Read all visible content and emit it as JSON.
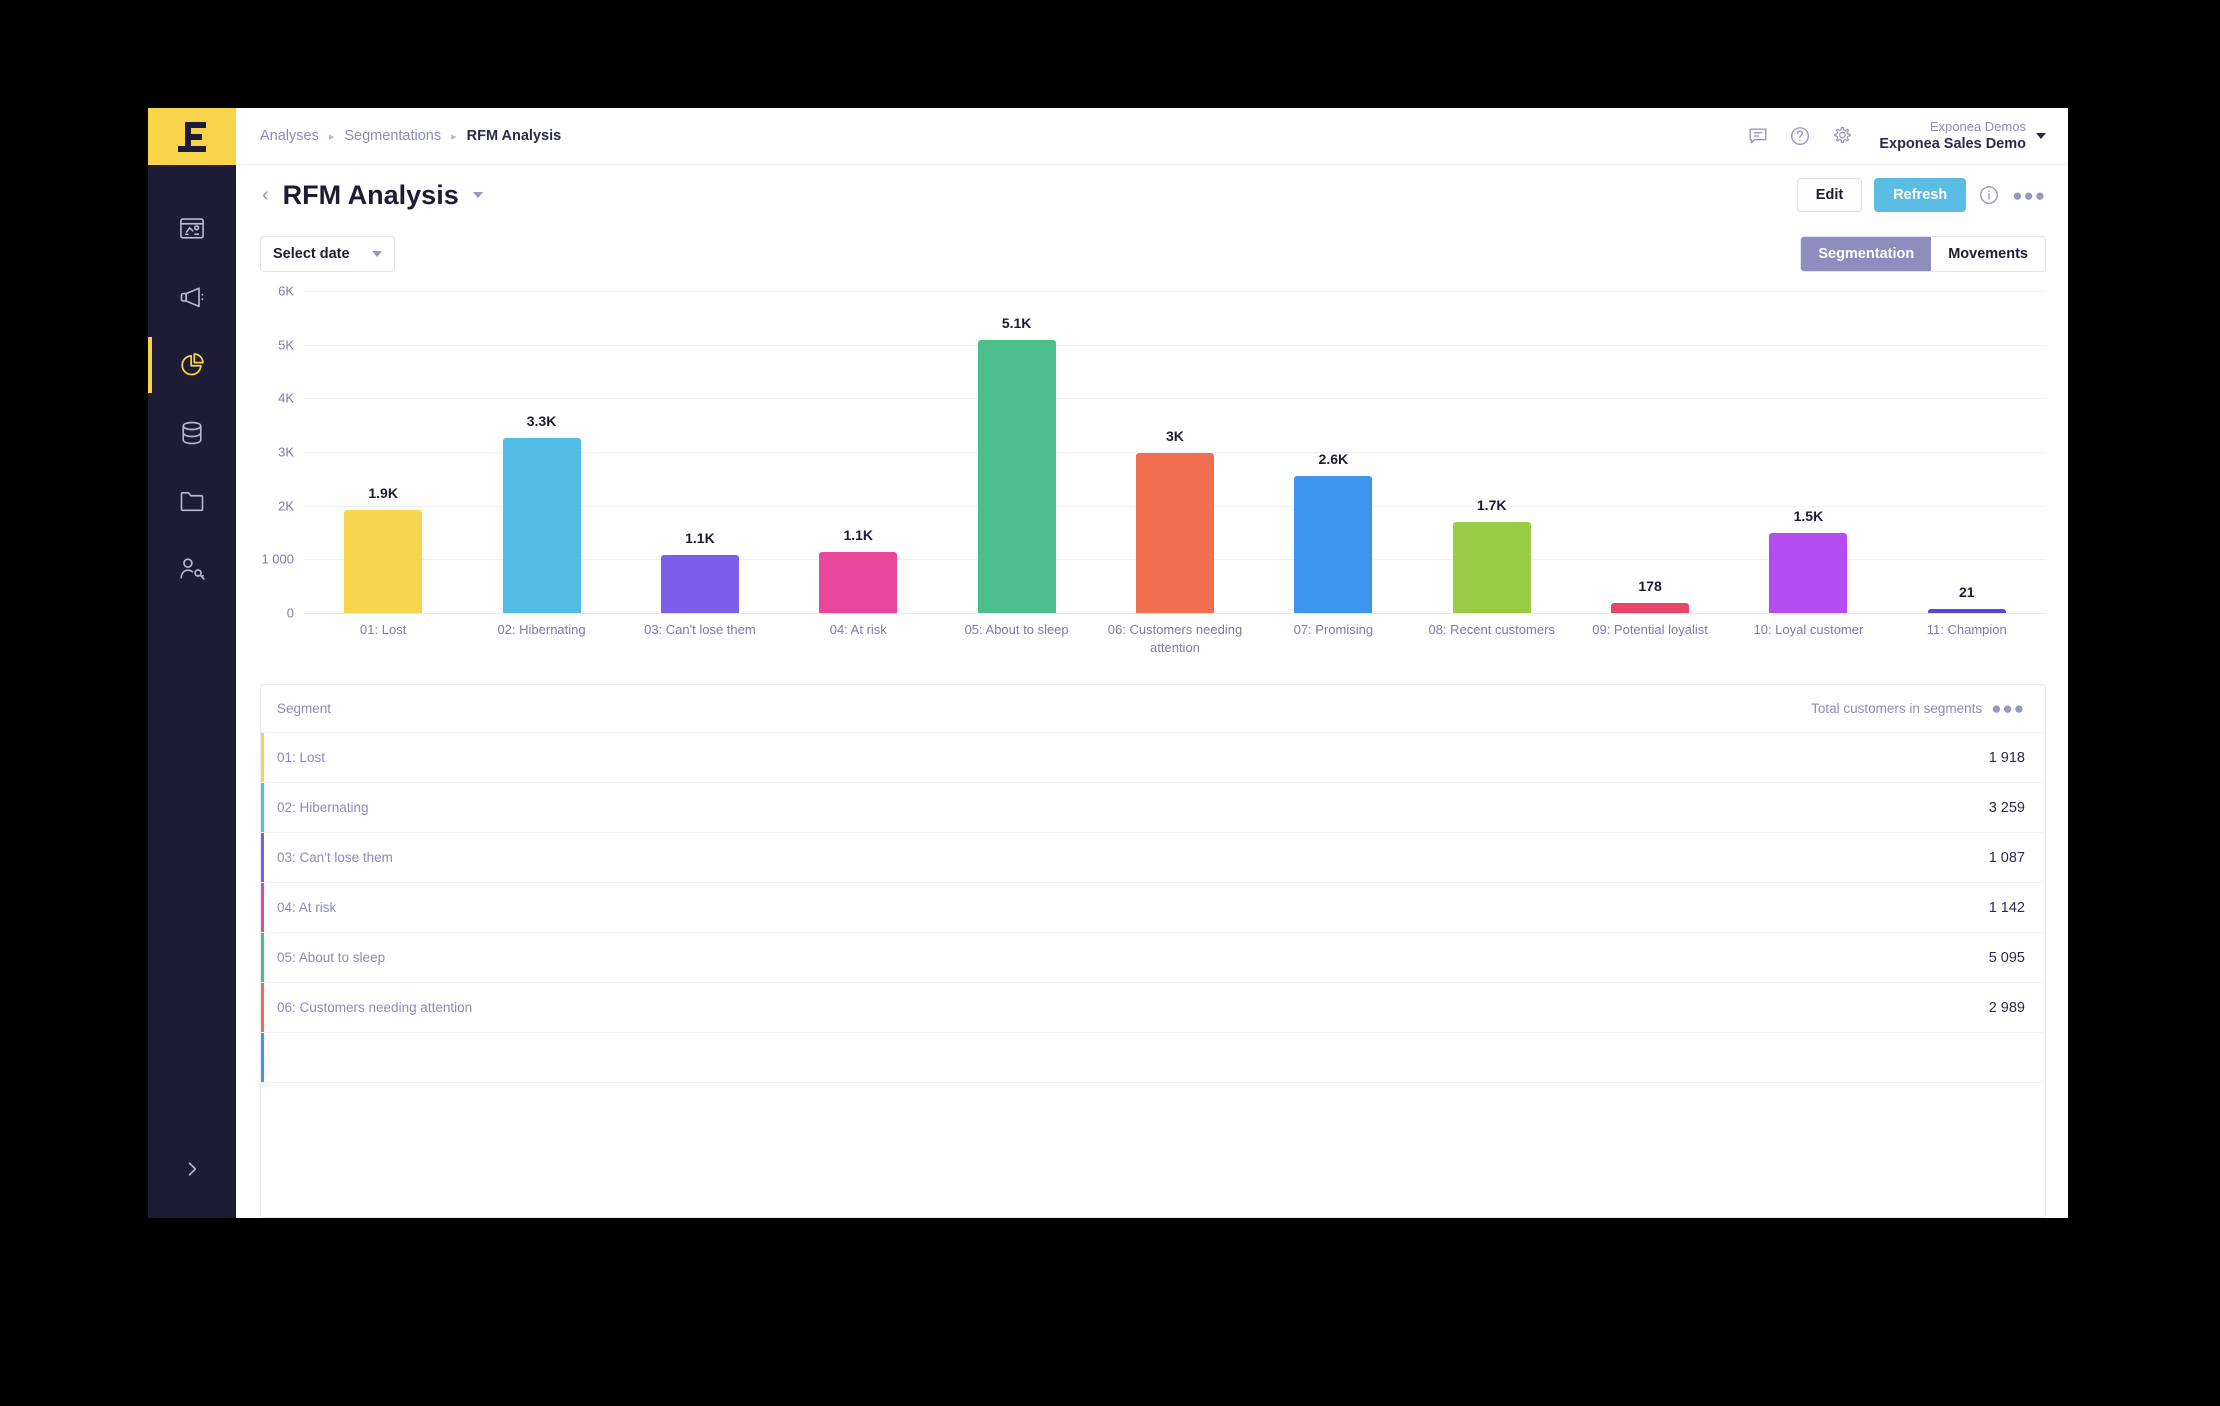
{
  "app": {
    "logo_name": "exponea-logo"
  },
  "sidebar": {
    "items": [
      {
        "name": "dashboards",
        "icon": "dashboard-icon",
        "active": false
      },
      {
        "name": "campaigns",
        "icon": "megaphone-icon",
        "active": false
      },
      {
        "name": "analyses",
        "icon": "pie-chart-icon",
        "active": true
      },
      {
        "name": "data",
        "icon": "database-icon",
        "active": false
      },
      {
        "name": "assets",
        "icon": "folder-icon",
        "active": false
      },
      {
        "name": "customers",
        "icon": "user-key-icon",
        "active": false
      }
    ],
    "expand_icon": "chevron-right-icon"
  },
  "topbar": {
    "breadcrumbs": [
      {
        "label": "Analyses",
        "current": false
      },
      {
        "label": "Segmentations",
        "current": false
      },
      {
        "label": "RFM Analysis",
        "current": true
      }
    ],
    "separator": "▸",
    "icons": [
      {
        "name": "feedback-icon"
      },
      {
        "name": "help-icon"
      },
      {
        "name": "gear-icon"
      }
    ],
    "account": {
      "organization": "Exponea Demos",
      "project": "Exponea Sales Demo"
    }
  },
  "pagehead": {
    "back_icon": "chevron-left-icon",
    "title": "RFM Analysis",
    "title_caret_icon": "chevron-down-icon",
    "edit_label": "Edit",
    "refresh_label": "Refresh",
    "info_icon": "info-icon",
    "more_label": "●●●"
  },
  "toolbar": {
    "date_label": "Select date",
    "date_caret_icon": "chevron-down-icon",
    "tabs": [
      {
        "label": "Segmentation",
        "active": true
      },
      {
        "label": "Movements",
        "active": false
      }
    ]
  },
  "chart_data": {
    "type": "bar",
    "title": "",
    "xlabel": "",
    "ylabel": "",
    "ylim": [
      0,
      6000
    ],
    "grid": true,
    "legend": "none",
    "ytick_labels": [
      "6K",
      "5K",
      "4K",
      "3K",
      "2K",
      "1 000",
      "0"
    ],
    "ytick_values": [
      6000,
      5000,
      4000,
      3000,
      2000,
      1000,
      0
    ],
    "categories": [
      "01: Lost",
      "02: Hibernating",
      "03: Can't lose them",
      "04: At risk",
      "05: About to sleep",
      "06: Customers needing attention",
      "07: Promising",
      "08: Recent customers",
      "09: Potential loyalist",
      "10: Loyal customer",
      "11: Champion"
    ],
    "values": [
      1918,
      3259,
      1087,
      1142,
      5095,
      2989,
      2557,
      1690,
      178,
      1493,
      21
    ],
    "data_labels": [
      "1.9K",
      "3.3K",
      "1.1K",
      "1.1K",
      "5.1K",
      "3K",
      "2.6K",
      "1.7K",
      "178",
      "1.5K",
      "21"
    ],
    "colors": [
      "#F7D44F",
      "#52BCE6",
      "#7B5FEA",
      "#E8479B",
      "#4CBE8C",
      "#EF6F50",
      "#3D96ED",
      "#9BCC45",
      "#E8456B",
      "#B44CF0",
      "#5546D8"
    ]
  },
  "table": {
    "columns": [
      "Segment",
      "Total customers in segments"
    ],
    "column_more_label": "●●●",
    "rows": [
      {
        "segment": "01: Lost",
        "total": "1 918",
        "color": "#F7D44F"
      },
      {
        "segment": "02: Hibernating",
        "total": "3 259",
        "color": "#52BCE6"
      },
      {
        "segment": "03: Can't lose them",
        "total": "1 087",
        "color": "#7B5FEA"
      },
      {
        "segment": "04: At risk",
        "total": "1 142",
        "color": "#E8479B"
      },
      {
        "segment": "05: About to sleep",
        "total": "5 095",
        "color": "#4CBE8C"
      },
      {
        "segment": "06: Customers needing attention",
        "total": "2 989",
        "color": "#EF6F50"
      },
      {
        "segment": "",
        "total": "",
        "color": "#3D96ED"
      }
    ]
  },
  "colors": {
    "brand_yellow": "#F7D449",
    "sidebar_bg": "#1E1B34",
    "accent_blue": "#5BBCE4",
    "tab_active": "#8D8DBE",
    "text_dark": "#1E1B34",
    "text_muted": "#8B8CB8"
  }
}
